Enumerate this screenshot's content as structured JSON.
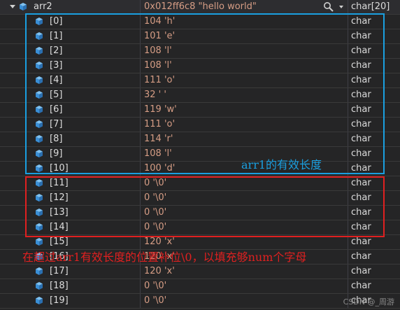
{
  "watch": {
    "header": {
      "name": "arr2",
      "value": "0x012ff6c8 \"hello world\"",
      "type": "char[20]"
    },
    "rows": [
      {
        "index": "[0]",
        "value": "104 'h'",
        "type": "char"
      },
      {
        "index": "[1]",
        "value": "101 'e'",
        "type": "char"
      },
      {
        "index": "[2]",
        "value": "108 'l'",
        "type": "char"
      },
      {
        "index": "[3]",
        "value": "108 'l'",
        "type": "char"
      },
      {
        "index": "[4]",
        "value": "111 'o'",
        "type": "char"
      },
      {
        "index": "[5]",
        "value": "32 ' '",
        "type": "char"
      },
      {
        "index": "[6]",
        "value": "119 'w'",
        "type": "char"
      },
      {
        "index": "[7]",
        "value": "111 'o'",
        "type": "char"
      },
      {
        "index": "[8]",
        "value": "114 'r'",
        "type": "char"
      },
      {
        "index": "[9]",
        "value": "108 'l'",
        "type": "char"
      },
      {
        "index": "[10]",
        "value": "100 'd'",
        "type": "char"
      },
      {
        "index": "[11]",
        "value": "0 '\\0'",
        "type": "char"
      },
      {
        "index": "[12]",
        "value": "0 '\\0'",
        "type": "char"
      },
      {
        "index": "[13]",
        "value": "0 '\\0'",
        "type": "char"
      },
      {
        "index": "[14]",
        "value": "0 '\\0'",
        "type": "char"
      },
      {
        "index": "[15]",
        "value": "120 'x'",
        "type": "char"
      },
      {
        "index": "[16]",
        "value": "120 'x'",
        "type": "char"
      },
      {
        "index": "[17]",
        "value": "120 'x'",
        "type": "char"
      },
      {
        "index": "[18]",
        "value": "0 '\\0'",
        "type": "char"
      },
      {
        "index": "[19]",
        "value": "0 '\\0'",
        "type": "char"
      }
    ]
  },
  "annotations": {
    "blue_note": "arr1的有效长度",
    "red_note": "在超过arr1有效长度的位置补位\\0，以填充够num个字母"
  },
  "watermark": "CSDN @_周游",
  "icons": {
    "header": "cube-icon",
    "search": "search-icon",
    "expander": "expander-icon"
  },
  "colors": {
    "blue_box": "#1a9fe0",
    "red_box": "#e02020",
    "value_text": "#d69d85",
    "icon_blue": "#4aa3e8"
  }
}
